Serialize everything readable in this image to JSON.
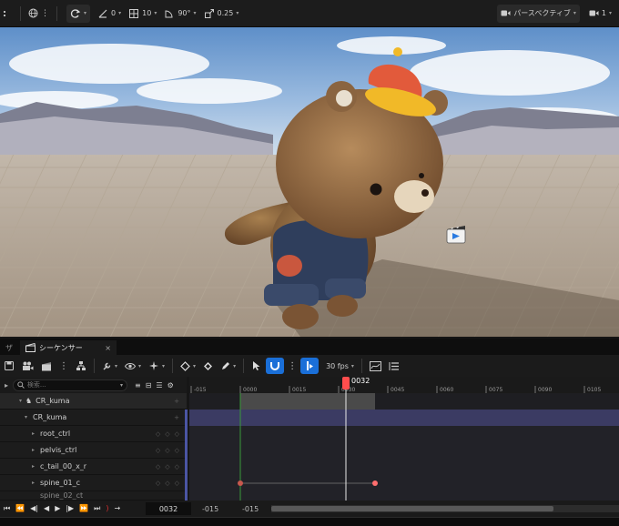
{
  "viewport_toolbar": {
    "snap_rotation": "0",
    "grid_size": "10",
    "rotation_snap": "90°",
    "scale_snap": "0.25",
    "perspective_label": "パースペクティブ",
    "camera_speed": "1"
  },
  "viewport": {
    "actor_name": "CR_kuma"
  },
  "sequencer": {
    "prev_tab_label": "ザ",
    "tab_label": "シーケンサー",
    "close_icon_glyph": "×",
    "fps_label": "30 fps",
    "search_placeholder": "検索...",
    "playhead_frame": "0032",
    "ruler_ticks": [
      "-015",
      "0000",
      "0015",
      "0030",
      "0045",
      "0060",
      "0075",
      "0090",
      "0105"
    ],
    "tracks": [
      {
        "label": "CR_kuma",
        "level": 0
      },
      {
        "label": "CR_kuma",
        "level": 1
      },
      {
        "label": "root_ctrl",
        "level": 2
      },
      {
        "label": "pelvis_ctrl",
        "level": 2
      },
      {
        "label": "c_tail_00_x_r",
        "level": 2
      },
      {
        "label": "spine_01_c",
        "level": 2
      },
      {
        "label": "spine_02_ct",
        "level": 2
      }
    ],
    "current_frame": "0032",
    "start_frame": "-015",
    "end_frame": "-015"
  },
  "colors": {
    "accent_blue": "#1a6fd8",
    "playhead_red": "#ff4d4d",
    "track_purple": "#3b3b63"
  }
}
